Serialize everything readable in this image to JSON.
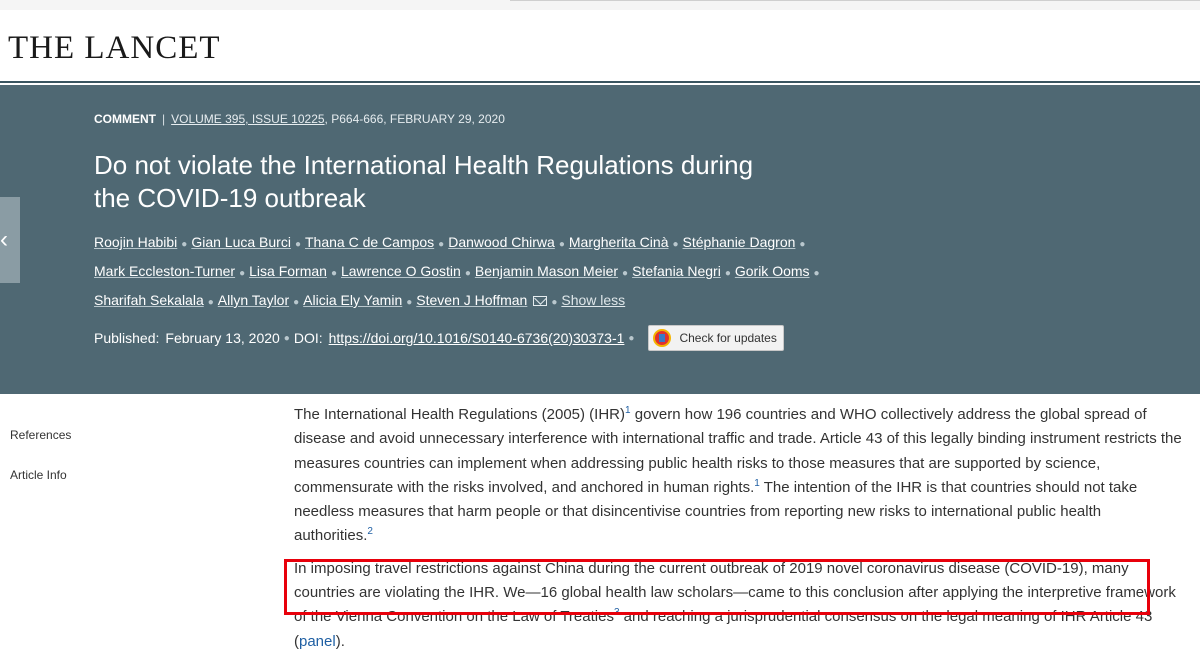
{
  "journal": {
    "name": "THE LANCET"
  },
  "article": {
    "type": "COMMENT",
    "volume_issue": "VOLUME 395, ISSUE 10225",
    "pages_date": ", P664-666, FEBRUARY 29, 2020",
    "title_line1": "Do not violate the International Health Regulations during",
    "title_line2": "the COVID-19 outbreak",
    "authors": [
      "Roojin Habibi",
      "Gian Luca Burci",
      "Thana C de Campos",
      "Danwood Chirwa",
      "Margherita Cinà",
      "Stéphanie Dagron",
      "Mark Eccleston-Turner",
      "Lisa Forman",
      "Lawrence O Gostin",
      "Benjamin Mason Meier",
      "Stefania Negri",
      "Gorik Ooms",
      "Sharifah Sekalala",
      "Allyn Taylor",
      "Alicia Ely Yamin",
      "Steven J Hoffman"
    ],
    "show_less": "Show less",
    "published_label": "Published:",
    "published_date": "February 13, 2020",
    "doi_label": "DOI:",
    "doi_link": "https://doi.org/10.1016/S0140-6736(20)30373-1",
    "check_updates": "Check for updates",
    "icons": {
      "email": "envelope-icon",
      "crossmark": "crossmark-icon",
      "side": "chevron-left-icon"
    }
  },
  "leftnav": {
    "items": [
      "References",
      "Article Info"
    ]
  },
  "body": {
    "p1_a": "The International Health Regulations (2005) (IHR)",
    "p1_ref1": "1",
    "p1_b": " govern how 196 countries and WHO collectively address the global spread of disease and avoid unnecessary interference with international traffic and trade. Article 43 of this legally binding instrument restricts the measures countries can implement when addressing public health risks to those measures that are supported by science, commensurate with the risks involved, and anchored in human rights.",
    "p1_ref2": "1",
    "p1_c": " The intention of the IHR is that countries should not take needless measures that harm people or that disincentivise countries from reporting new risks to international public health authorities.",
    "p1_ref3": "2",
    "p2_a": "In imposing travel restrictions against China during the current outbreak of 2019 novel coronavirus disease (COVID-19), many countries are violating the IHR. We—16 global health law scholars—came to this conclusion after applying the interpretive framework of the Vienna Convention on the Law of Treaties",
    "p2_ref": "3",
    "p2_b": " and reaching a jurisprudential consensus on the legal meaning of IHR Article 43 (",
    "p2_link": "panel",
    "p2_c": ")."
  },
  "colors": {
    "hero_bg": "#4f6873",
    "highlight": "#e8000b",
    "link": "#1f5fa3"
  }
}
